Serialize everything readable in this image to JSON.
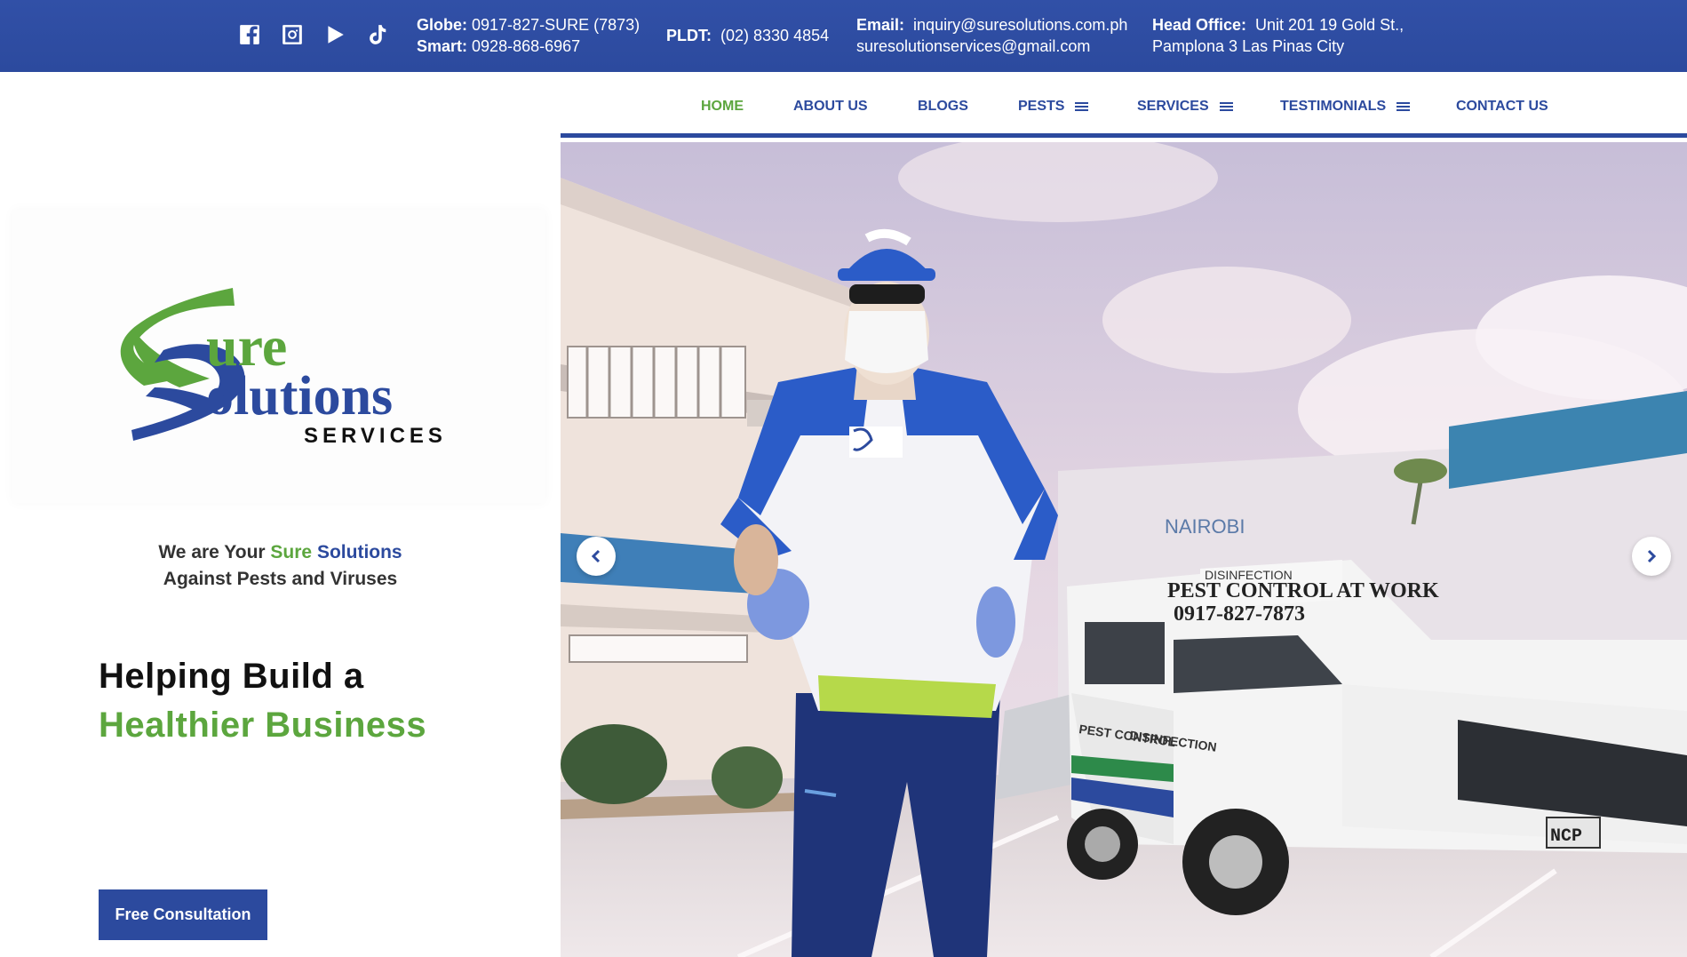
{
  "topbar": {
    "social": [
      {
        "icon": "facebook-icon"
      },
      {
        "icon": "instagram-icon"
      },
      {
        "icon": "youtube-icon"
      },
      {
        "icon": "tiktok-icon"
      }
    ],
    "globe_label": "Globe:",
    "globe_value": "0917-827-SURE (7873)",
    "smart_label": "Smart:",
    "smart_value": "0928-868-6967",
    "pldt_label": "PLDT:",
    "pldt_value": "(02) 8330 4854",
    "email_label": "Email:",
    "email_value_1": "inquiry@suresolutions.com.ph",
    "email_value_2": "suresolutionservices@gmail.com",
    "office_label": "Head Office:",
    "office_value_1": "Unit 201 19 Gold St.,",
    "office_value_2": "Pamplona 3 Las Pinas City"
  },
  "logo": {
    "word1": "ure",
    "word2": "olutions",
    "word3": "SERVICES"
  },
  "tagline": {
    "prefix": "We are Your",
    "green": "Sure",
    "blue": "Solutions",
    "line2": "Against Pests and Viruses"
  },
  "headline": {
    "line1": "Helping Build a",
    "line2": "Healthier Business"
  },
  "cta": {
    "label": "Free Consultation"
  },
  "nav": {
    "items": [
      {
        "label": "HOME",
        "active": true,
        "menu": false
      },
      {
        "label": "ABOUT US",
        "active": false,
        "menu": false
      },
      {
        "label": "BLOGS",
        "active": false,
        "menu": false
      },
      {
        "label": "PESTS",
        "active": false,
        "menu": true
      },
      {
        "label": "SERVICES",
        "active": false,
        "menu": true
      },
      {
        "label": "TESTIMONIALS",
        "active": false,
        "menu": true
      },
      {
        "label": "CONTACT US",
        "active": false,
        "menu": false
      }
    ]
  },
  "hero": {
    "van_text_1": "DISINFECTION",
    "van_text_2": "PEST CONTROL AT WORK",
    "van_text_3": "0917-827-7873",
    "van_side_1": "PEST CONTROL",
    "van_side_2": "DISINFECTION",
    "plate": "NCP"
  },
  "colors": {
    "brand_blue": "#2c4a9e",
    "brand_green": "#5ca63e"
  }
}
